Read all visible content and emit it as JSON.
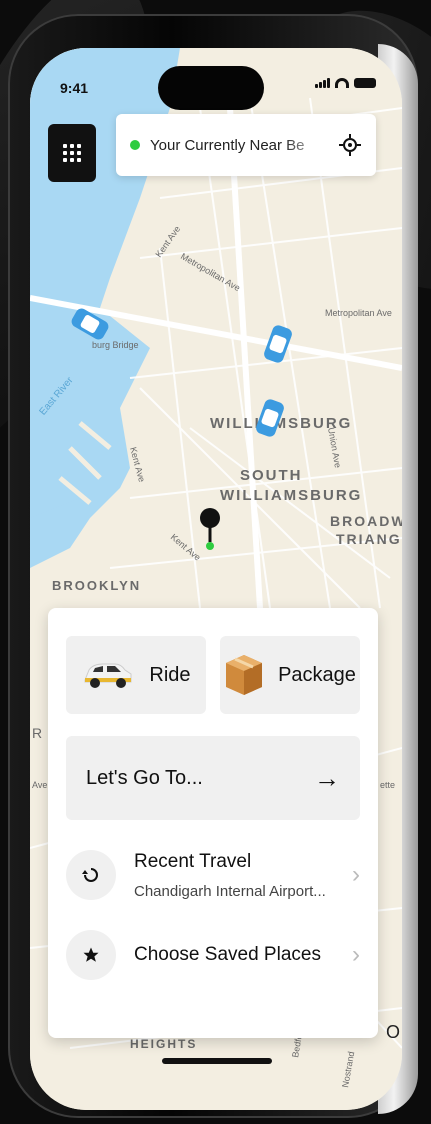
{
  "status_bar": {
    "time": "9:41"
  },
  "location_bar": {
    "text": "Your Currently Near Be",
    "status_color": "#2ecc40"
  },
  "map": {
    "labels": {
      "williamsburg": "WILLIAMSBURG",
      "south": "SOUTH",
      "south2": "WILLIAMSBURG",
      "broadway": "BROADW",
      "triangle": "TRIANG",
      "brooklyn": "BROOKLYN",
      "east_river": "East River",
      "kent_ave": "Kent Ave",
      "kent_ave2": "Kent Ave",
      "kent_ave3": "Kent Ave",
      "metropolitan": "Metropolitan Ave",
      "metropolitan2": "Metropolitan Ave",
      "bridge": "burg Bridge",
      "union": "Union Ave",
      "bedford": "Bedford",
      "nostrand": "Nostrand",
      "heights": "HEIGHTS",
      "r": "R",
      "o": "O",
      "ave": "Ave",
      "ette": "ette"
    }
  },
  "services": [
    {
      "label": "Ride",
      "icon": "car-icon"
    },
    {
      "label": "Package",
      "icon": "box-icon"
    }
  ],
  "destination": {
    "label": "Let's Go To...",
    "icon": "arrow-right-icon"
  },
  "recent": {
    "title": "Recent Travel",
    "subtitle": "Chandigarh Internal Airport...",
    "icon": "history-icon"
  },
  "saved": {
    "title": "Choose Saved Places",
    "icon": "star-icon"
  },
  "colors": {
    "water": "#a9d8f3",
    "map_bg": "#f3eee1",
    "accent_green": "#2ecc40",
    "taxi": "#3c9be0"
  }
}
